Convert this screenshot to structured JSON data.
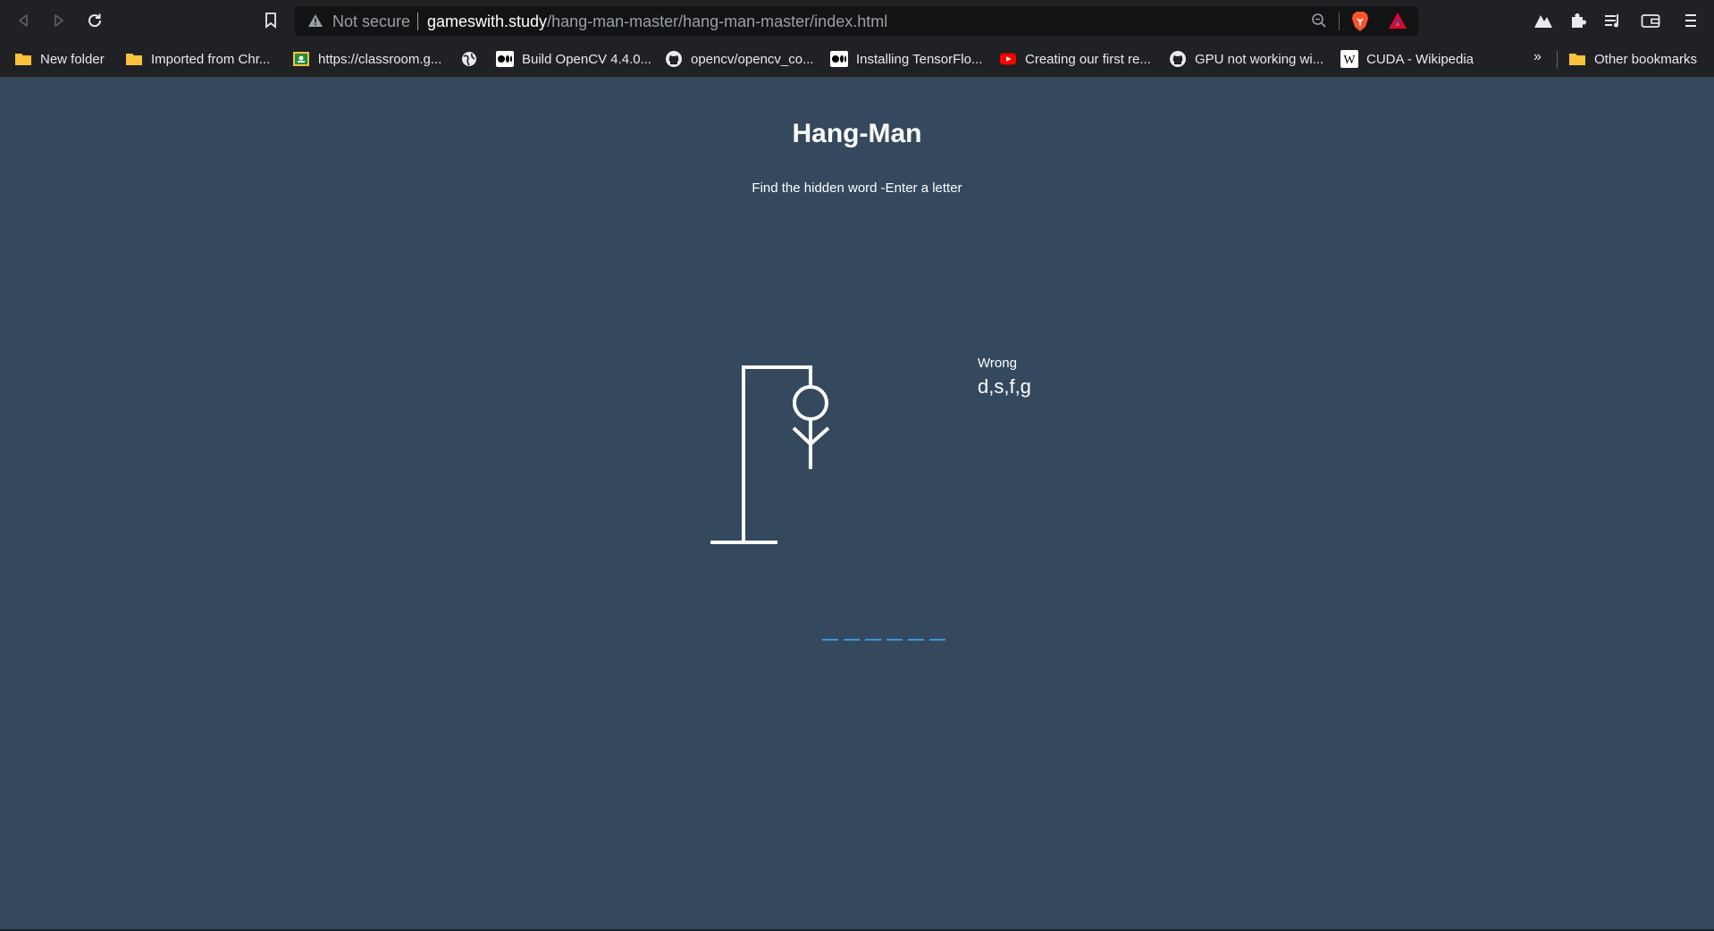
{
  "browser": {
    "address": {
      "security_label": "Not secure",
      "host": "gameswith.study",
      "path": "/hang-man-master/hang-man-master/index.html"
    },
    "bookmarks": [
      {
        "label": "New folder",
        "icon": "folder-icon"
      },
      {
        "label": "Imported from Chr...",
        "icon": "folder-icon"
      },
      {
        "label": "https://classroom.g...",
        "icon": "classroom-icon"
      },
      {
        "label": "",
        "icon": "globe-icon"
      },
      {
        "label": "Build OpenCV 4.4.0...",
        "icon": "medium-icon"
      },
      {
        "label": "opencv/opencv_co...",
        "icon": "github-icon"
      },
      {
        "label": "Installing TensorFlo...",
        "icon": "medium-icon"
      },
      {
        "label": "Creating our first re...",
        "icon": "youtube-icon"
      },
      {
        "label": "GPU not working wi...",
        "icon": "github-icon"
      },
      {
        "label": "CUDA - Wikipedia",
        "icon": "wikipedia-icon"
      }
    ],
    "more_bookmarks": "»",
    "other_bookmarks": "Other bookmarks"
  },
  "game": {
    "title": "Hang-Man",
    "subtitle": "Find the hidden word -Enter a letter",
    "wrong_label": "Wrong",
    "wrong_letters": "d,s,f,g",
    "word_length": 6
  },
  "colors": {
    "page_bg": "#34495e",
    "slot": "#3498db",
    "chrome_bg": "#202124"
  }
}
